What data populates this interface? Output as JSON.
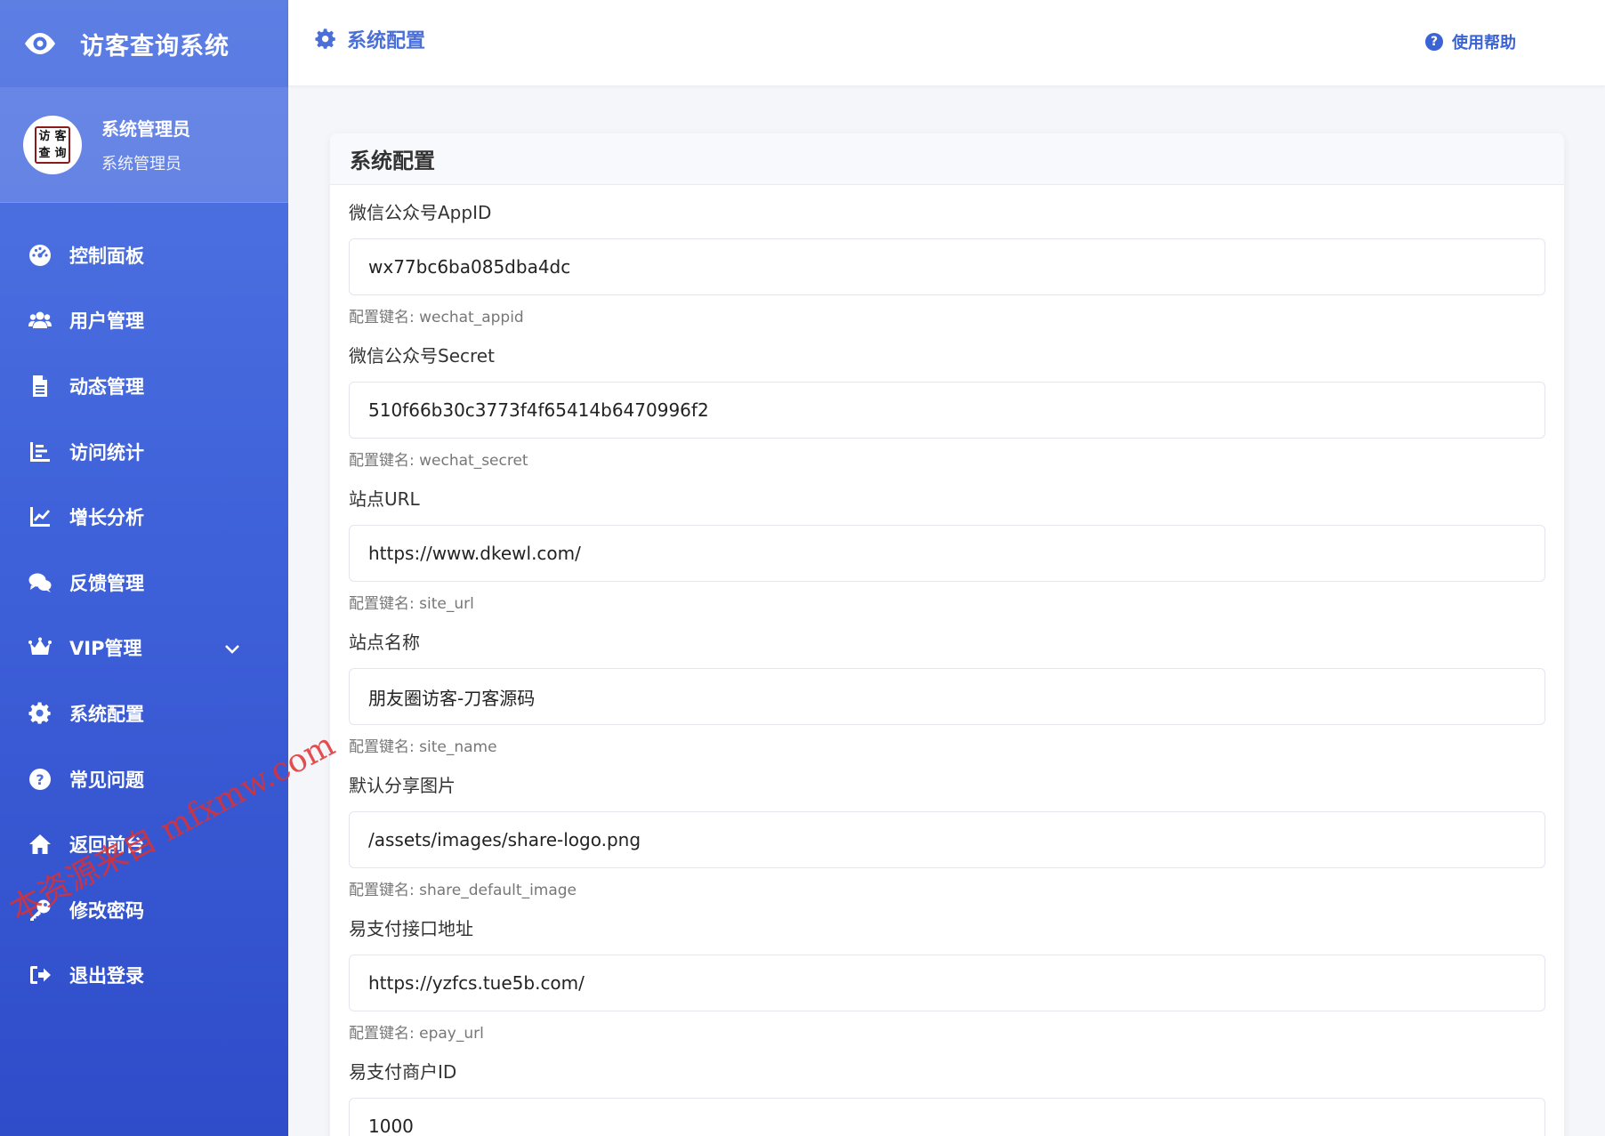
{
  "app": {
    "title": "访客查询系统",
    "logo_text": [
      "访",
      "客",
      "查",
      "询"
    ]
  },
  "profile": {
    "name": "系统管理员",
    "role": "系统管理员"
  },
  "sidebar": {
    "items": [
      {
        "label": "控制面板",
        "icon": "dashboard-icon"
      },
      {
        "label": "用户管理",
        "icon": "users-icon"
      },
      {
        "label": "动态管理",
        "icon": "file-icon"
      },
      {
        "label": "访问统计",
        "icon": "bar-list-icon"
      },
      {
        "label": "增长分析",
        "icon": "line-chart-icon"
      },
      {
        "label": "反馈管理",
        "icon": "comments-icon"
      },
      {
        "label": "VIP管理",
        "icon": "crown-icon"
      },
      {
        "label": "系统配置",
        "icon": "gear-icon"
      },
      {
        "label": "常见问题",
        "icon": "question-icon"
      },
      {
        "label": "返回前台",
        "icon": "home-icon"
      },
      {
        "label": "修改密码",
        "icon": "key-icon"
      },
      {
        "label": "退出登录",
        "icon": "logout-icon"
      }
    ]
  },
  "header": {
    "breadcrumb": "系统配置",
    "help_label": "使用帮助"
  },
  "card": {
    "title": "系统配置",
    "fields": [
      {
        "label": "微信公众号AppID",
        "value": "wx77bc6ba085dba4dc",
        "key": "配置键名: wechat_appid"
      },
      {
        "label": "微信公众号Secret",
        "value": "510f66b30c3773f4f65414b6470996f2",
        "key": "配置键名: wechat_secret"
      },
      {
        "label": "站点URL",
        "value": "https://www.dkewl.com/",
        "key": "配置键名: site_url"
      },
      {
        "label": "站点名称",
        "value": "朋友圈访客-刀客源码",
        "key": "配置键名: site_name"
      },
      {
        "label": "默认分享图片",
        "value": "/assets/images/share-logo.png",
        "key": "配置键名: share_default_image"
      },
      {
        "label": "易支付接口地址",
        "value": "https://yzfcs.tue5b.com/",
        "key": "配置键名: epay_url"
      },
      {
        "label": "易支付商户ID",
        "value": "1000",
        "key": ""
      }
    ]
  },
  "watermark": "本资源来自 mfxmw.com",
  "colors": {
    "sidebar_top": "#5377e3",
    "sidebar_bottom": "#2f4cc9",
    "accent": "#4a6fd9"
  }
}
